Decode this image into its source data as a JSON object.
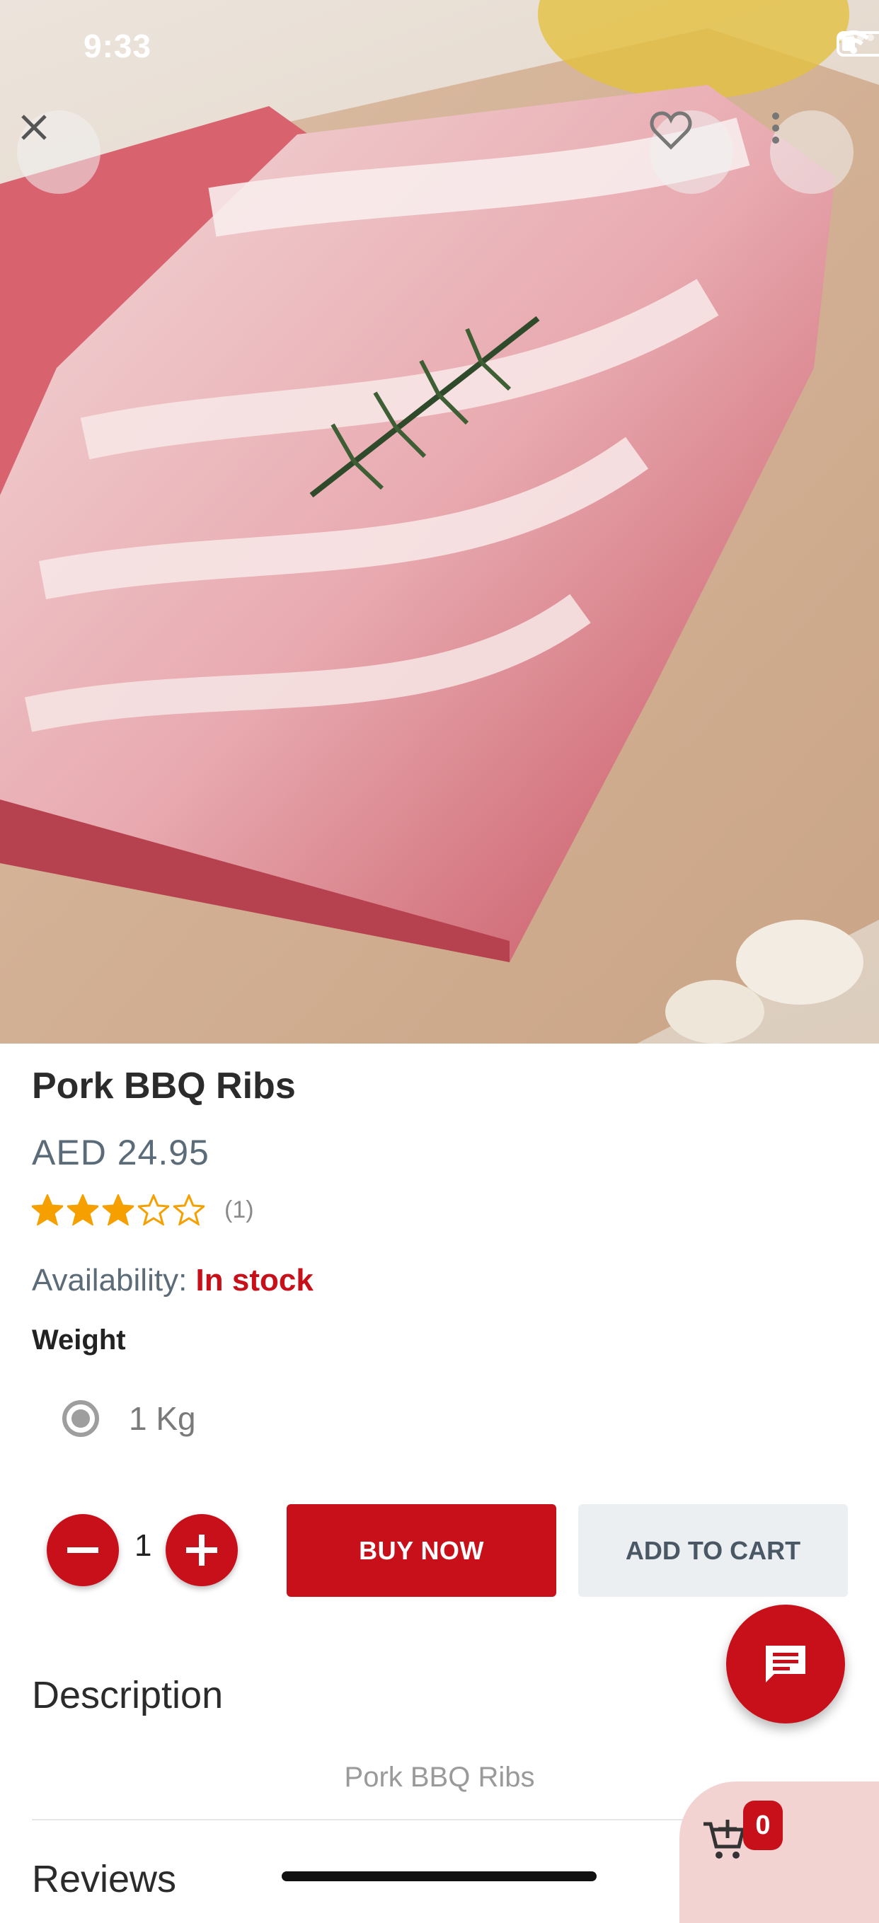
{
  "status": {
    "time": "9:33"
  },
  "product": {
    "name": "Pork BBQ Ribs",
    "price": "AED 24.95",
    "rating": 3,
    "rating_max": 5,
    "review_count": "(1)",
    "availability_label": "Availability:",
    "availability_value": "In stock",
    "weight_label": "Weight",
    "weight_option": "1 Kg"
  },
  "actions": {
    "quantity": "1",
    "buy_now": "BUY NOW",
    "add_to_cart": "ADD TO CART"
  },
  "sections": {
    "description_title": "Description",
    "description_text": "Pork BBQ Ribs",
    "reviews_title": "Reviews"
  },
  "cart": {
    "count": "0"
  },
  "icons": {
    "close": "close-icon",
    "favorite": "heart-icon",
    "more": "more-vertical-icon",
    "chat": "chat-icon",
    "cart": "cart-add-icon",
    "star_filled": "star-icon",
    "star_empty": "star-outline-icon"
  },
  "colors": {
    "accent": "#c8101a",
    "star": "#f5a000",
    "secondary_button": "#eceff1",
    "cart_widget_bg": "#f3d2d2"
  }
}
